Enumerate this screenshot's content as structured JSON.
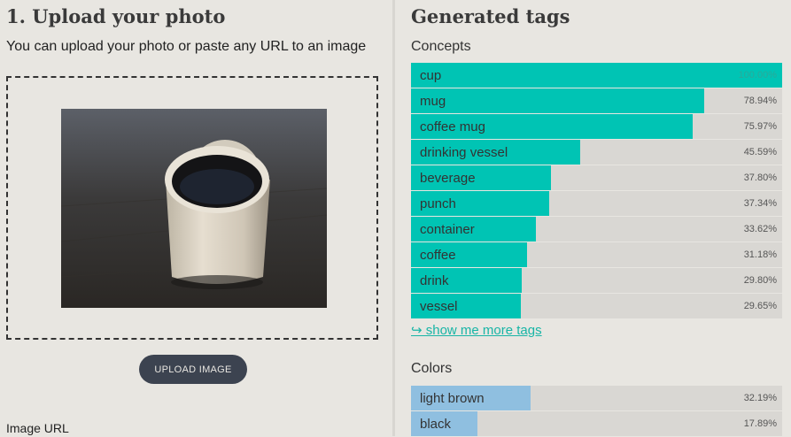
{
  "upload": {
    "title": "1. Upload your photo",
    "subtitle": "You can upload your photo or paste any URL to an image",
    "button_label": "UPLOAD IMAGE",
    "url_label": "Image URL"
  },
  "tags": {
    "title": "Generated tags",
    "concepts_label": "Concepts",
    "colors_label": "Colors",
    "more_link": "↪ show me more tags",
    "concepts": [
      {
        "name": "cup",
        "percent": "100.00%",
        "value": 100.0
      },
      {
        "name": "mug",
        "percent": "78.94%",
        "value": 78.94
      },
      {
        "name": "coffee mug",
        "percent": "75.97%",
        "value": 75.97
      },
      {
        "name": "drinking vessel",
        "percent": "45.59%",
        "value": 45.59
      },
      {
        "name": "beverage",
        "percent": "37.80%",
        "value": 37.8
      },
      {
        "name": "punch",
        "percent": "37.34%",
        "value": 37.34
      },
      {
        "name": "container",
        "percent": "33.62%",
        "value": 33.62
      },
      {
        "name": "coffee",
        "percent": "31.18%",
        "value": 31.18
      },
      {
        "name": "drink",
        "percent": "29.80%",
        "value": 29.8
      },
      {
        "name": "vessel",
        "percent": "29.65%",
        "value": 29.65
      }
    ],
    "colors": [
      {
        "name": "light brown",
        "percent": "32.19%",
        "value": 32.19
      },
      {
        "name": "black",
        "percent": "17.89%",
        "value": 17.89
      }
    ]
  },
  "style": {
    "concept_color": "#00c4b4",
    "color_bar_color": "#8fbfe0"
  }
}
